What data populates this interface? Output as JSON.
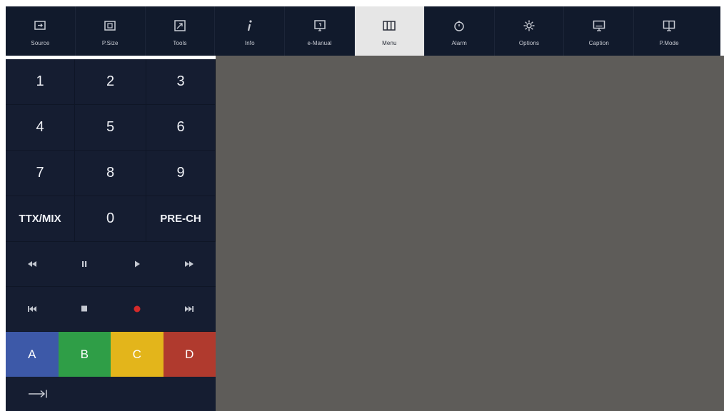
{
  "toolbar": {
    "items": [
      {
        "label": "Source",
        "icon": "source-icon"
      },
      {
        "label": "P.Size",
        "icon": "picture-size-icon"
      },
      {
        "label": "Tools",
        "icon": "tools-icon"
      },
      {
        "label": "Info",
        "icon": "info-icon"
      },
      {
        "label": "e-Manual",
        "icon": "e-manual-icon"
      },
      {
        "label": "Menu",
        "icon": "menu-icon",
        "active": true
      },
      {
        "label": "Alarm",
        "icon": "alarm-icon"
      },
      {
        "label": "Options",
        "icon": "options-icon"
      },
      {
        "label": "Caption",
        "icon": "caption-icon"
      },
      {
        "label": "P.Mode",
        "icon": "picture-mode-icon"
      }
    ]
  },
  "keypad": {
    "keys": [
      "1",
      "2",
      "3",
      "4",
      "5",
      "6",
      "7",
      "8",
      "9",
      "TTX/MIX",
      "0",
      "PRE-CH"
    ]
  },
  "media": {
    "row1": [
      "rewind-icon",
      "pause-icon",
      "play-icon",
      "fast-forward-icon"
    ],
    "row2": [
      "skip-previous-icon",
      "stop-icon",
      "record-icon",
      "skip-next-icon"
    ]
  },
  "color_keys": [
    {
      "label": "A",
      "color": "#3d59a8"
    },
    {
      "label": "B",
      "color": "#2f9e47"
    },
    {
      "label": "C",
      "color": "#e3b51b"
    },
    {
      "label": "D",
      "color": "#b03a2e"
    }
  ],
  "tab_key": {
    "icon": "tab-arrow-icon"
  },
  "colors": {
    "toolbar_bg": "#111a2c",
    "panel_bg": "#151d31",
    "content_bg": "#5e5c59",
    "active_tab_bg": "#e6e6e6",
    "record": "#d32a2a"
  }
}
